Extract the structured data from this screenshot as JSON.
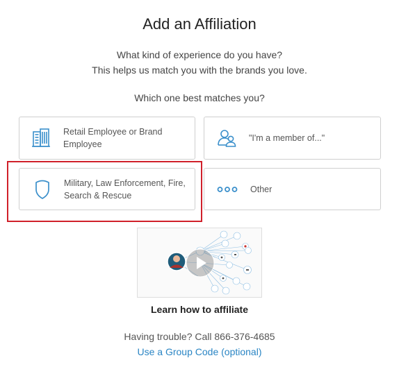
{
  "page": {
    "title": "Add an Affiliation",
    "subtitle_line1": "What kind of experience do you have?",
    "subtitle_line2": "This helps us match you with the brands you love.",
    "question": "Which one best matches you?"
  },
  "options": [
    {
      "label": "Retail Employee or Brand Employee",
      "icon": "building-icon"
    },
    {
      "label": "\"I'm a member of...\"",
      "icon": "people-icon"
    },
    {
      "label": "Military, Law Enforcement, Fire, Search & Rescue",
      "icon": "shield-icon",
      "highlighted": true
    },
    {
      "label": "Other",
      "icon": "dots-icon"
    }
  ],
  "video": {
    "caption": "Learn how to affiliate",
    "icon": "play-icon"
  },
  "footer": {
    "trouble_text": "Having trouble? Call 866-376-4685",
    "group_code_link": "Use a Group Code (optional)"
  },
  "colors": {
    "accent": "#2a85c4",
    "highlight_border": "#d0202a",
    "card_border": "#cfcfcf"
  }
}
